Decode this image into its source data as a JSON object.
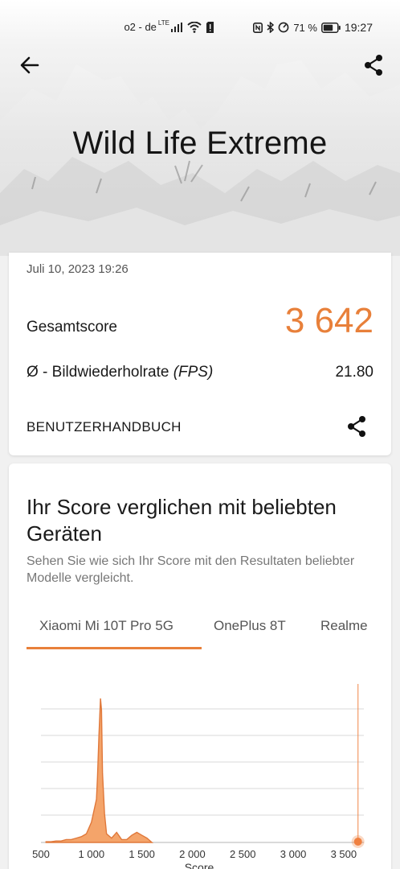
{
  "status_bar": {
    "carrier": "o2 - de",
    "network": "LTE",
    "battery_percent": "71 %",
    "time": "19:27",
    "icons": [
      "signal-icon",
      "wifi-icon",
      "sim-alert-icon",
      "nfc-icon",
      "bluetooth-icon",
      "data-saver-icon",
      "battery-icon"
    ]
  },
  "header": {
    "title": "Wild Life Extreme",
    "back_icon": "arrow-left-icon",
    "share_icon": "share-icon"
  },
  "result": {
    "date": "Juli 10, 2023 19:26",
    "score_label": "Gesamtscore",
    "score_value": "3 642",
    "fps_label_prefix": "Ø - Bildwiederholrate ",
    "fps_label_unit": "(FPS)",
    "fps_value": "21.80",
    "manual_link": "BENUTZERHANDBUCH",
    "accent_color": "#e8803a"
  },
  "comparison": {
    "title": "Ihr Score verglichen mit beliebten Geräten",
    "subtitle": "Sehen Sie wie sich Ihr Score mit den Resultaten beliebter Modelle vergleicht.",
    "tabs": [
      {
        "label": "Xiaomi Mi 10T Pro 5G",
        "active": true
      },
      {
        "label": "OnePlus 8T",
        "active": false
      },
      {
        "label": "Realme",
        "active": false
      }
    ]
  },
  "chart_data": {
    "type": "area",
    "xlabel": "Score",
    "xlim": [
      500,
      3700
    ],
    "x_ticks": [
      "500",
      "1 000",
      "1 500",
      "2 000",
      "2 500",
      "3 000",
      "3 500"
    ],
    "x_tick_values": [
      500,
      1000,
      1500,
      2000,
      2500,
      3000,
      3500
    ],
    "series": [
      {
        "type": "distribution",
        "x": [
          550,
          600,
          650,
          700,
          750,
          800,
          850,
          900,
          950,
          1000,
          1050,
          1060,
          1075,
          1090,
          1100,
          1110,
          1130,
          1150,
          1200,
          1250,
          1300,
          1350,
          1400,
          1450,
          1500,
          1550,
          1600
        ],
        "y": [
          0.005,
          0.005,
          0.01,
          0.01,
          0.02,
          0.02,
          0.03,
          0.04,
          0.06,
          0.14,
          0.3,
          0.45,
          0.75,
          1.0,
          0.92,
          0.48,
          0.2,
          0.06,
          0.03,
          0.07,
          0.02,
          0.02,
          0.05,
          0.07,
          0.05,
          0.03,
          0.0
        ]
      }
    ],
    "marker_value": 3642,
    "grid": true,
    "colors": {
      "fill": "#f4a46a",
      "stroke": "#e0783a",
      "marker": "#f08040"
    }
  }
}
